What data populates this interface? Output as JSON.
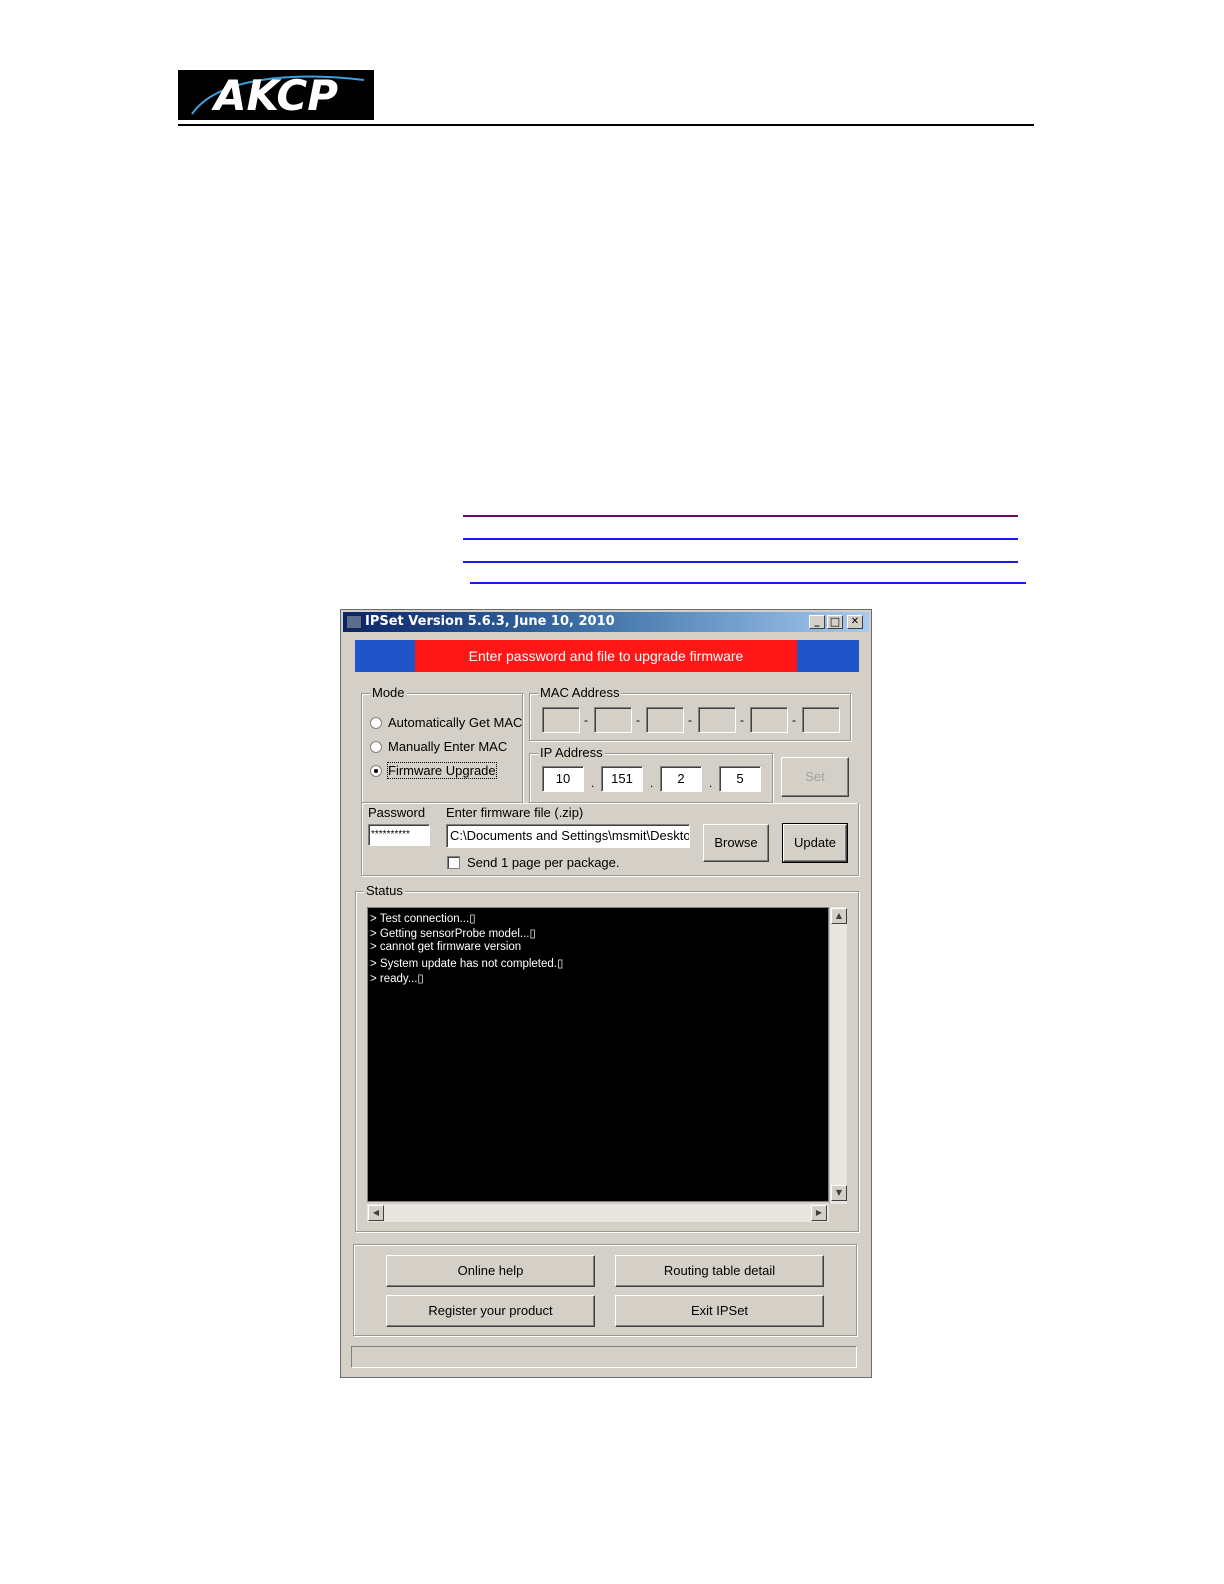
{
  "logo": {
    "text": "AKCP"
  },
  "colors": {
    "link_underline": "#1a1aee",
    "link_underline_visited": "#6a0a6a",
    "banner_blue": "#1f55c9",
    "banner_red": "#ff1717"
  },
  "window": {
    "title": "IPSet Version 5.6.3,  June 10, 2010",
    "controls": {
      "minimize": "_",
      "maximize": "□",
      "close": "✕"
    },
    "banner": "Enter password and file to upgrade firmware",
    "mode": {
      "legend": "Mode",
      "options": [
        "Automatically Get MAC",
        "Manually Enter MAC",
        "Firmware Upgrade"
      ],
      "selected": "Firmware Upgrade"
    },
    "mac": {
      "legend": "MAC Address",
      "fields": [
        "",
        "",
        "",
        "",
        "",
        ""
      ],
      "separator": "-"
    },
    "ip": {
      "legend": "IP Address",
      "octets": [
        "10",
        "151",
        "2",
        "5"
      ],
      "separator": "."
    },
    "set_button": "Set",
    "password": {
      "label": "Password",
      "value": "**********"
    },
    "firmware": {
      "label": "Enter firmware file (.zip)",
      "value": "C:\\Documents and Settings\\msmit\\Deskto"
    },
    "browse_button": "Browse",
    "update_button": "Update",
    "send_one_page": {
      "label": "Send 1 page per package.",
      "checked": false
    },
    "status": {
      "legend": "Status",
      "lines": [
        "> Test connection...▯",
        "> Getting sensorProbe model...▯",
        "> cannot get firmware version",
        "> System update has not completed.▯",
        "> ready...▯"
      ]
    },
    "buttons": {
      "online_help": "Online help",
      "routing_table": "Routing table detail",
      "register": "Register your product",
      "exit": "Exit IPSet"
    },
    "statusbar_text": ""
  }
}
